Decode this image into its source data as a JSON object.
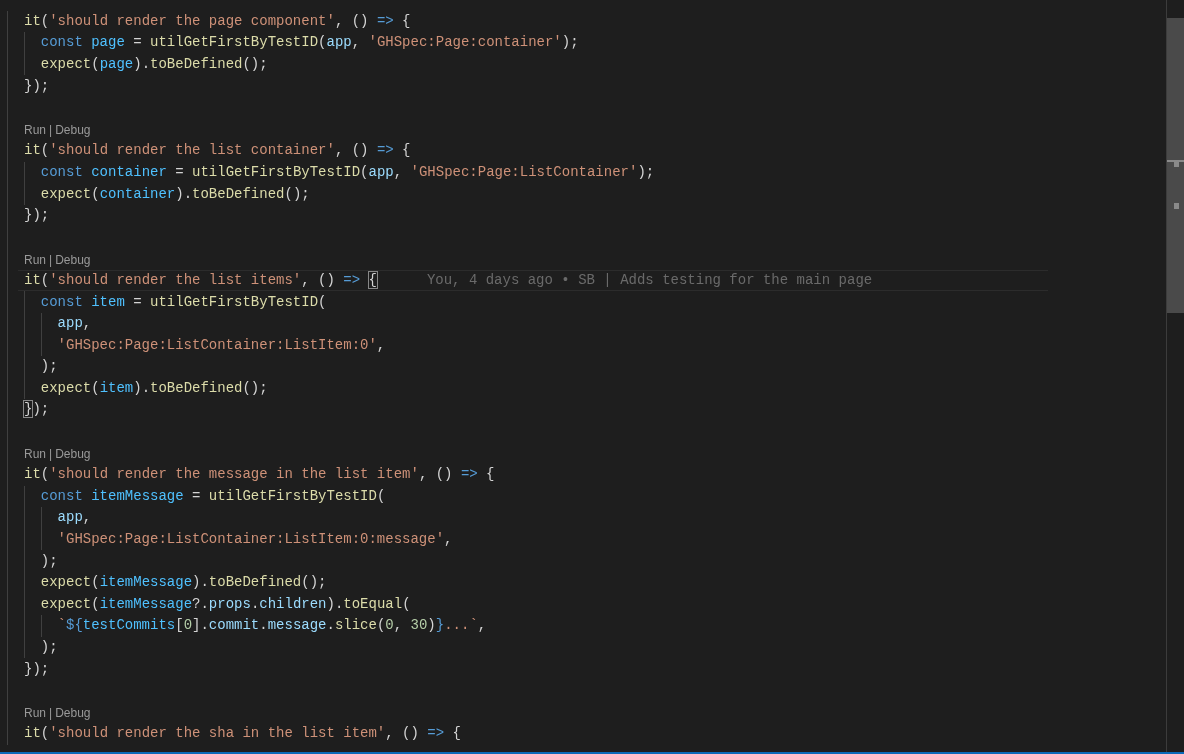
{
  "editor": {
    "lines": [
      {
        "kind": "code",
        "current": false,
        "tokens": [
          {
            "kind": "fn",
            "text": "it"
          },
          {
            "kind": "plain",
            "text": "("
          },
          {
            "kind": "str",
            "text": "'should render the page component'"
          },
          {
            "kind": "plain",
            "text": ", () "
          },
          {
            "kind": "kw",
            "text": "=>"
          },
          {
            "kind": "plain",
            "text": " {"
          }
        ]
      },
      {
        "kind": "code",
        "current": false,
        "tokens": [
          {
            "kind": "kw",
            "text": "  const "
          },
          {
            "kind": "var",
            "text": "page"
          },
          {
            "kind": "plain",
            "text": " = "
          },
          {
            "kind": "fn",
            "text": "utilGetFirstByTestID"
          },
          {
            "kind": "plain",
            "text": "("
          },
          {
            "kind": "prop",
            "text": "app"
          },
          {
            "kind": "plain",
            "text": ", "
          },
          {
            "kind": "str",
            "text": "'GHSpec:Page:container'"
          },
          {
            "kind": "plain",
            "text": ");"
          }
        ]
      },
      {
        "kind": "code",
        "current": false,
        "tokens": [
          {
            "kind": "fn",
            "text": "  expect"
          },
          {
            "kind": "plain",
            "text": "("
          },
          {
            "kind": "var",
            "text": "page"
          },
          {
            "kind": "plain",
            "text": ")."
          },
          {
            "kind": "fn",
            "text": "toBeDefined"
          },
          {
            "kind": "plain",
            "text": "();"
          }
        ]
      },
      {
        "kind": "code",
        "current": false,
        "tokens": [
          {
            "kind": "plain",
            "text": "});"
          }
        ]
      },
      {
        "kind": "blank"
      },
      {
        "kind": "codelens",
        "actions": [
          "Run",
          "Debug"
        ],
        "separator": "|"
      },
      {
        "kind": "code",
        "current": false,
        "tokens": [
          {
            "kind": "fn",
            "text": "it"
          },
          {
            "kind": "plain",
            "text": "("
          },
          {
            "kind": "str",
            "text": "'should render the list container'"
          },
          {
            "kind": "plain",
            "text": ", () "
          },
          {
            "kind": "kw",
            "text": "=>"
          },
          {
            "kind": "plain",
            "text": " {"
          }
        ]
      },
      {
        "kind": "code",
        "current": false,
        "tokens": [
          {
            "kind": "kw",
            "text": "  const "
          },
          {
            "kind": "var",
            "text": "container"
          },
          {
            "kind": "plain",
            "text": " = "
          },
          {
            "kind": "fn",
            "text": "utilGetFirstByTestID"
          },
          {
            "kind": "plain",
            "text": "("
          },
          {
            "kind": "prop",
            "text": "app"
          },
          {
            "kind": "plain",
            "text": ", "
          },
          {
            "kind": "str",
            "text": "'GHSpec:Page:ListContainer'"
          },
          {
            "kind": "plain",
            "text": ");"
          }
        ]
      },
      {
        "kind": "code",
        "current": false,
        "tokens": [
          {
            "kind": "fn",
            "text": "  expect"
          },
          {
            "kind": "plain",
            "text": "("
          },
          {
            "kind": "var",
            "text": "container"
          },
          {
            "kind": "plain",
            "text": ")."
          },
          {
            "kind": "fn",
            "text": "toBeDefined"
          },
          {
            "kind": "plain",
            "text": "();"
          }
        ]
      },
      {
        "kind": "code",
        "current": false,
        "tokens": [
          {
            "kind": "plain",
            "text": "});"
          }
        ]
      },
      {
        "kind": "blank"
      },
      {
        "kind": "codelens",
        "actions": [
          "Run",
          "Debug"
        ],
        "separator": "|"
      },
      {
        "kind": "code",
        "current": true,
        "blame": "You, 4 days ago • SB | Adds testing for the main page",
        "tokens": [
          {
            "kind": "fn",
            "text": "it"
          },
          {
            "kind": "plain",
            "text": "("
          },
          {
            "kind": "str",
            "text": "'should render the list items'"
          },
          {
            "kind": "plain",
            "text": ", () "
          },
          {
            "kind": "kw",
            "text": "=> "
          },
          {
            "kind": "match",
            "text": "{"
          }
        ]
      },
      {
        "kind": "code",
        "current": false,
        "tokens": [
          {
            "kind": "kw",
            "text": "  const "
          },
          {
            "kind": "var",
            "text": "item"
          },
          {
            "kind": "plain",
            "text": " = "
          },
          {
            "kind": "fn",
            "text": "utilGetFirstByTestID"
          },
          {
            "kind": "plain",
            "text": "("
          }
        ]
      },
      {
        "kind": "code",
        "current": false,
        "tokens": [
          {
            "kind": "prop",
            "text": "    app"
          },
          {
            "kind": "plain",
            "text": ","
          }
        ]
      },
      {
        "kind": "code",
        "current": false,
        "tokens": [
          {
            "kind": "str",
            "text": "    'GHSpec:Page:ListContainer:ListItem:0'"
          },
          {
            "kind": "plain",
            "text": ","
          }
        ]
      },
      {
        "kind": "code",
        "current": false,
        "tokens": [
          {
            "kind": "plain",
            "text": "  );"
          }
        ]
      },
      {
        "kind": "code",
        "current": false,
        "tokens": [
          {
            "kind": "fn",
            "text": "  expect"
          },
          {
            "kind": "plain",
            "text": "("
          },
          {
            "kind": "var",
            "text": "item"
          },
          {
            "kind": "plain",
            "text": ")."
          },
          {
            "kind": "fn",
            "text": "toBeDefined"
          },
          {
            "kind": "plain",
            "text": "();"
          }
        ]
      },
      {
        "kind": "code",
        "current": false,
        "tokens": [
          {
            "kind": "match",
            "text": "}"
          },
          {
            "kind": "plain",
            "text": ");"
          }
        ]
      },
      {
        "kind": "blank"
      },
      {
        "kind": "codelens",
        "actions": [
          "Run",
          "Debug"
        ],
        "separator": "|"
      },
      {
        "kind": "code",
        "current": false,
        "tokens": [
          {
            "kind": "fn",
            "text": "it"
          },
          {
            "kind": "plain",
            "text": "("
          },
          {
            "kind": "str",
            "text": "'should render the message in the list item'"
          },
          {
            "kind": "plain",
            "text": ", () "
          },
          {
            "kind": "kw",
            "text": "=>"
          },
          {
            "kind": "plain",
            "text": " {"
          }
        ]
      },
      {
        "kind": "code",
        "current": false,
        "tokens": [
          {
            "kind": "kw",
            "text": "  const "
          },
          {
            "kind": "var",
            "text": "itemMessage"
          },
          {
            "kind": "plain",
            "text": " = "
          },
          {
            "kind": "fn",
            "text": "utilGetFirstByTestID"
          },
          {
            "kind": "plain",
            "text": "("
          }
        ]
      },
      {
        "kind": "code",
        "current": false,
        "tokens": [
          {
            "kind": "prop",
            "text": "    app"
          },
          {
            "kind": "plain",
            "text": ","
          }
        ]
      },
      {
        "kind": "code",
        "current": false,
        "tokens": [
          {
            "kind": "str",
            "text": "    'GHSpec:Page:ListContainer:ListItem:0:message'"
          },
          {
            "kind": "plain",
            "text": ","
          }
        ]
      },
      {
        "kind": "code",
        "current": false,
        "tokens": [
          {
            "kind": "plain",
            "text": "  );"
          }
        ]
      },
      {
        "kind": "code",
        "current": false,
        "tokens": [
          {
            "kind": "fn",
            "text": "  expect"
          },
          {
            "kind": "plain",
            "text": "("
          },
          {
            "kind": "var",
            "text": "itemMessage"
          },
          {
            "kind": "plain",
            "text": ")."
          },
          {
            "kind": "fn",
            "text": "toBeDefined"
          },
          {
            "kind": "plain",
            "text": "();"
          }
        ]
      },
      {
        "kind": "code",
        "current": false,
        "tokens": [
          {
            "kind": "fn",
            "text": "  expect"
          },
          {
            "kind": "plain",
            "text": "("
          },
          {
            "kind": "var",
            "text": "itemMessage"
          },
          {
            "kind": "plain",
            "text": "?."
          },
          {
            "kind": "prop",
            "text": "props"
          },
          {
            "kind": "plain",
            "text": "."
          },
          {
            "kind": "prop",
            "text": "children"
          },
          {
            "kind": "plain",
            "text": ")."
          },
          {
            "kind": "fn",
            "text": "toEqual"
          },
          {
            "kind": "plain",
            "text": "("
          }
        ]
      },
      {
        "kind": "code",
        "current": false,
        "tokens": [
          {
            "kind": "str",
            "text": "    `"
          },
          {
            "kind": "kw",
            "text": "${"
          },
          {
            "kind": "var",
            "text": "testCommits"
          },
          {
            "kind": "plain",
            "text": "["
          },
          {
            "kind": "num",
            "text": "0"
          },
          {
            "kind": "plain",
            "text": "]."
          },
          {
            "kind": "prop",
            "text": "commit"
          },
          {
            "kind": "plain",
            "text": "."
          },
          {
            "kind": "prop",
            "text": "message"
          },
          {
            "kind": "plain",
            "text": "."
          },
          {
            "kind": "fn",
            "text": "slice"
          },
          {
            "kind": "plain",
            "text": "("
          },
          {
            "kind": "num",
            "text": "0"
          },
          {
            "kind": "plain",
            "text": ", "
          },
          {
            "kind": "num",
            "text": "30"
          },
          {
            "kind": "plain",
            "text": ")"
          },
          {
            "kind": "kw",
            "text": "}"
          },
          {
            "kind": "str",
            "text": "...`"
          },
          {
            "kind": "plain",
            "text": ","
          }
        ]
      },
      {
        "kind": "code",
        "current": false,
        "tokens": [
          {
            "kind": "plain",
            "text": "  );"
          }
        ]
      },
      {
        "kind": "code",
        "current": false,
        "tokens": [
          {
            "kind": "plain",
            "text": "});"
          }
        ]
      },
      {
        "kind": "blank"
      },
      {
        "kind": "codelens",
        "actions": [
          "Run",
          "Debug"
        ],
        "separator": "|"
      },
      {
        "kind": "code",
        "current": false,
        "tokens": [
          {
            "kind": "fn",
            "text": "it"
          },
          {
            "kind": "plain",
            "text": "("
          },
          {
            "kind": "str",
            "text": "'should render the sha in the list item'"
          },
          {
            "kind": "plain",
            "text": ", () "
          },
          {
            "kind": "kw",
            "text": "=>"
          },
          {
            "kind": "plain",
            "text": " {"
          }
        ]
      }
    ]
  }
}
